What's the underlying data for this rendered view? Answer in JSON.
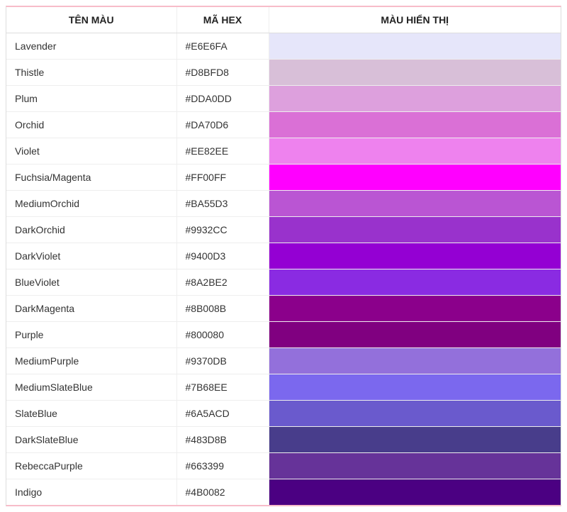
{
  "table": {
    "headers": {
      "name": "TÊN MÀU",
      "hex": "MÃ HEX",
      "swatch": "MÀU HIỂN THỊ"
    },
    "rows": [
      {
        "name": "Lavender",
        "hex": "#E6E6FA"
      },
      {
        "name": "Thistle",
        "hex": "#D8BFD8"
      },
      {
        "name": "Plum",
        "hex": "#DDA0DD"
      },
      {
        "name": "Orchid",
        "hex": "#DA70D6"
      },
      {
        "name": "Violet",
        "hex": "#EE82EE"
      },
      {
        "name": "Fuchsia/Magenta",
        "hex": "#FF00FF"
      },
      {
        "name": "MediumOrchid",
        "hex": "#BA55D3"
      },
      {
        "name": "DarkOrchid",
        "hex": "#9932CC"
      },
      {
        "name": "DarkViolet",
        "hex": "#9400D3"
      },
      {
        "name": "BlueViolet",
        "hex": "#8A2BE2"
      },
      {
        "name": "DarkMagenta",
        "hex": "#8B008B"
      },
      {
        "name": "Purple",
        "hex": "#800080"
      },
      {
        "name": "MediumPurple",
        "hex": "#9370DB"
      },
      {
        "name": "MediumSlateBlue",
        "hex": "#7B68EE"
      },
      {
        "name": "SlateBlue",
        "hex": "#6A5ACD"
      },
      {
        "name": "DarkSlateBlue",
        "hex": "#483D8B"
      },
      {
        "name": "RebeccaPurple",
        "hex": "#663399"
      },
      {
        "name": "Indigo",
        "hex": "#4B0082"
      }
    ]
  }
}
